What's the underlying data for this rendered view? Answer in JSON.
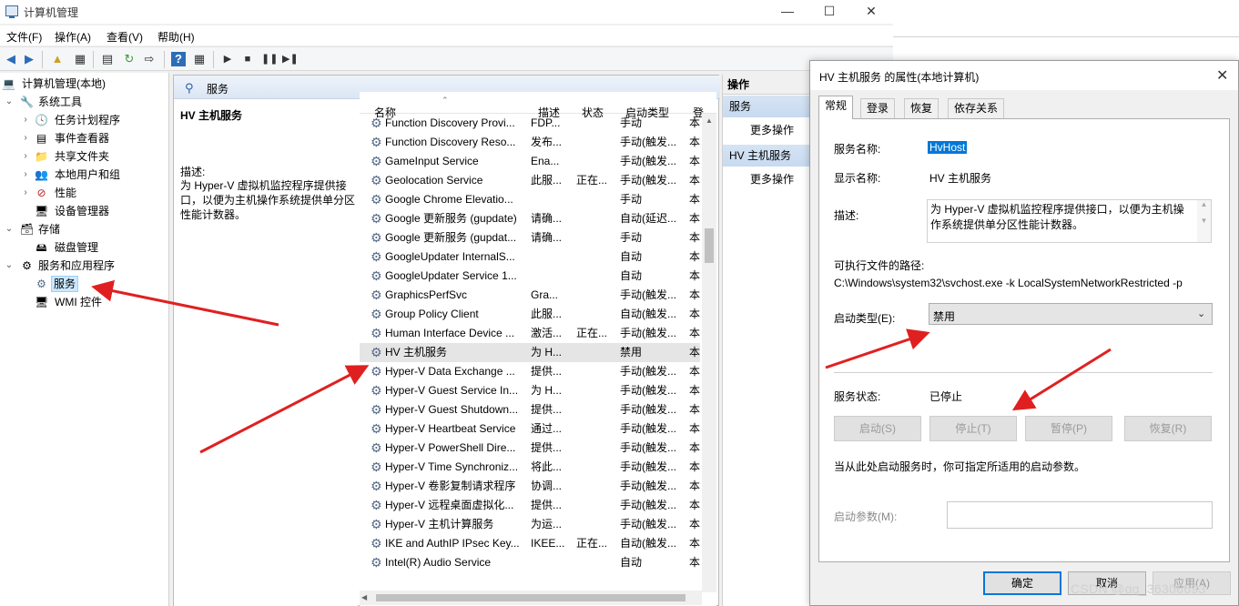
{
  "main": {
    "title": "计算机管理",
    "menus": [
      "文件(F)",
      "操作(A)",
      "查看(V)",
      "帮助(H)"
    ]
  },
  "tree": {
    "root": "计算机管理(本地)",
    "system_tools": "系统工具",
    "task_scheduler": "任务计划程序",
    "event_viewer": "事件查看器",
    "shared_folders": "共享文件夹",
    "local_users": "本地用户和组",
    "performance": "性能",
    "device_manager": "设备管理器",
    "storage": "存储",
    "disk_management": "磁盘管理",
    "services_apps": "服务和应用程序",
    "services": "服务",
    "wmi": "WMI 控件"
  },
  "services_panel": {
    "header": "服务",
    "selected_name": "HV 主机服务",
    "desc_label": "描述:",
    "desc_text": "为 Hyper-V 虚拟机监控程序提供接口，以便为主机操作系统提供单分区性能计数器。",
    "columns": [
      "名称",
      "描述",
      "状态",
      "启动类型",
      "登"
    ],
    "rows": [
      {
        "name": "Function Discovery Provi...",
        "desc": "FDP...",
        "state": "",
        "start": "手动",
        "login": "本"
      },
      {
        "name": "Function Discovery Reso...",
        "desc": "发布...",
        "state": "",
        "start": "手动(触发...",
        "login": "本"
      },
      {
        "name": "GameInput Service",
        "desc": "Ena...",
        "state": "",
        "start": "手动(触发...",
        "login": "本"
      },
      {
        "name": "Geolocation Service",
        "desc": "此服...",
        "state": "正在...",
        "start": "手动(触发...",
        "login": "本"
      },
      {
        "name": "Google Chrome Elevatio...",
        "desc": "",
        "state": "",
        "start": "手动",
        "login": "本"
      },
      {
        "name": "Google 更新服务 (gupdate)",
        "desc": "请确...",
        "state": "",
        "start": "自动(延迟...",
        "login": "本"
      },
      {
        "name": "Google 更新服务 (gupdat...",
        "desc": "请确...",
        "state": "",
        "start": "手动",
        "login": "本"
      },
      {
        "name": "GoogleUpdater InternalS...",
        "desc": "",
        "state": "",
        "start": "自动",
        "login": "本"
      },
      {
        "name": "GoogleUpdater Service 1...",
        "desc": "",
        "state": "",
        "start": "自动",
        "login": "本"
      },
      {
        "name": "GraphicsPerfSvc",
        "desc": "Gra...",
        "state": "",
        "start": "手动(触发...",
        "login": "本"
      },
      {
        "name": "Group Policy Client",
        "desc": "此服...",
        "state": "",
        "start": "自动(触发...",
        "login": "本"
      },
      {
        "name": "Human Interface Device ...",
        "desc": "激活...",
        "state": "正在...",
        "start": "手动(触发...",
        "login": "本"
      },
      {
        "name": "HV 主机服务",
        "desc": "为 H...",
        "state": "",
        "start": "禁用",
        "login": "本"
      },
      {
        "name": "Hyper-V Data Exchange ...",
        "desc": "提供...",
        "state": "",
        "start": "手动(触发...",
        "login": "本"
      },
      {
        "name": "Hyper-V Guest Service In...",
        "desc": "为 H...",
        "state": "",
        "start": "手动(触发...",
        "login": "本"
      },
      {
        "name": "Hyper-V Guest Shutdown...",
        "desc": "提供...",
        "state": "",
        "start": "手动(触发...",
        "login": "本"
      },
      {
        "name": "Hyper-V Heartbeat Service",
        "desc": "通过...",
        "state": "",
        "start": "手动(触发...",
        "login": "本"
      },
      {
        "name": "Hyper-V PowerShell Dire...",
        "desc": "提供...",
        "state": "",
        "start": "手动(触发...",
        "login": "本"
      },
      {
        "name": "Hyper-V Time Synchroniz...",
        "desc": "将此...",
        "state": "",
        "start": "手动(触发...",
        "login": "本"
      },
      {
        "name": "Hyper-V 卷影复制请求程序",
        "desc": "协调...",
        "state": "",
        "start": "手动(触发...",
        "login": "本"
      },
      {
        "name": "Hyper-V 远程桌面虚拟化...",
        "desc": "提供...",
        "state": "",
        "start": "手动(触发...",
        "login": "本"
      },
      {
        "name": "Hyper-V 主机计算服务",
        "desc": "为运...",
        "state": "",
        "start": "手动(触发...",
        "login": "本"
      },
      {
        "name": "IKE and AuthIP IPsec Key...",
        "desc": "IKEE...",
        "state": "正在...",
        "start": "自动(触发...",
        "login": "本"
      },
      {
        "name": "Intel(R) Audio Service",
        "desc": "",
        "state": "",
        "start": "自动",
        "login": "本"
      }
    ]
  },
  "actions": {
    "title": "操作",
    "group1": "服务",
    "more1": "更多操作",
    "group2": "HV 主机服务",
    "more2": "更多操作"
  },
  "dialog": {
    "title": "HV 主机服务 的属性(本地计算机)",
    "tabs": [
      "常规",
      "登录",
      "恢复",
      "依存关系"
    ],
    "service_name_label": "服务名称:",
    "service_name_value": "HvHost",
    "display_name_label": "显示名称:",
    "display_name_value": "HV 主机服务",
    "description_label": "描述:",
    "description_value": "为 Hyper-V 虚拟机监控程序提供接口，以便为主机操作系统提供单分区性能计数器。",
    "exe_path_label": "可执行文件的路径:",
    "exe_path_value": "C:\\Windows\\system32\\svchost.exe -k LocalSystemNetworkRestricted -p",
    "startup_type_label": "启动类型(E):",
    "startup_type_value": "禁用",
    "status_label": "服务状态:",
    "status_value": "已停止",
    "btn_start": "启动(S)",
    "btn_stop": "停止(T)",
    "btn_pause": "暂停(P)",
    "btn_resume": "恢复(R)",
    "hint": "当从此处启动服务时，你可指定所适用的启动参数。",
    "params_label": "启动参数(M):",
    "params_value": "",
    "btn_ok": "确定",
    "btn_cancel": "取消",
    "btn_apply": "应用(A)"
  },
  "watermark": "CSDN @qq_36306693",
  "colors": {
    "selection": "#0078d7",
    "annotation_arrow": "#e02020",
    "panel_header": "#dbe6f4"
  }
}
